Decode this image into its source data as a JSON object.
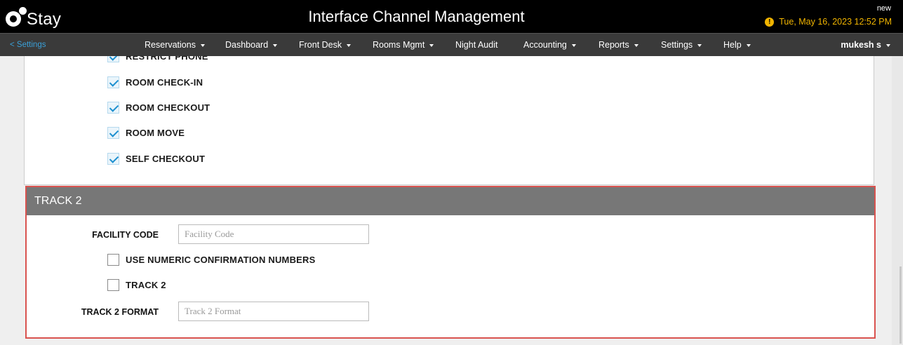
{
  "header": {
    "logo_text": "Stay",
    "title": "Interface Channel Management",
    "new_label": "new",
    "datetime": "Tue, May 16, 2023 12:52 PM"
  },
  "nav": {
    "back_label": "< Settings",
    "items": [
      {
        "label": "Reservations",
        "dropdown": true
      },
      {
        "label": "Dashboard",
        "dropdown": true
      },
      {
        "label": "Front Desk",
        "dropdown": true
      },
      {
        "label": "Rooms Mgmt",
        "dropdown": true
      },
      {
        "label": "Night Audit",
        "dropdown": false
      },
      {
        "label": "Accounting",
        "dropdown": true
      },
      {
        "label": "Reports",
        "dropdown": true
      },
      {
        "label": "Settings",
        "dropdown": true
      },
      {
        "label": "Help",
        "dropdown": true
      }
    ],
    "user": "mukesh s"
  },
  "options": [
    {
      "label": "RESTRICT PHONE",
      "checked": true
    },
    {
      "label": "ROOM CHECK-IN",
      "checked": true
    },
    {
      "label": "ROOM CHECKOUT",
      "checked": true
    },
    {
      "label": "ROOM MOVE",
      "checked": true
    },
    {
      "label": "SELF CHECKOUT",
      "checked": true
    }
  ],
  "track2": {
    "header": "TRACK 2",
    "facility_code_label": "FACILITY CODE",
    "facility_code_placeholder": "Facility Code",
    "facility_code_value": "",
    "numeric_conf_label": "USE NUMERIC CONFIRMATION NUMBERS",
    "numeric_conf_checked": false,
    "track2_label": "TRACK 2",
    "track2_checked": false,
    "format_label": "TRACK 2 FORMAT",
    "format_placeholder": "Track 2 Format",
    "format_value": ""
  },
  "colors": {
    "accent": "#1e90d0",
    "warning": "#f0b400",
    "highlight_border": "#d9534f",
    "section_header": "#777777"
  }
}
